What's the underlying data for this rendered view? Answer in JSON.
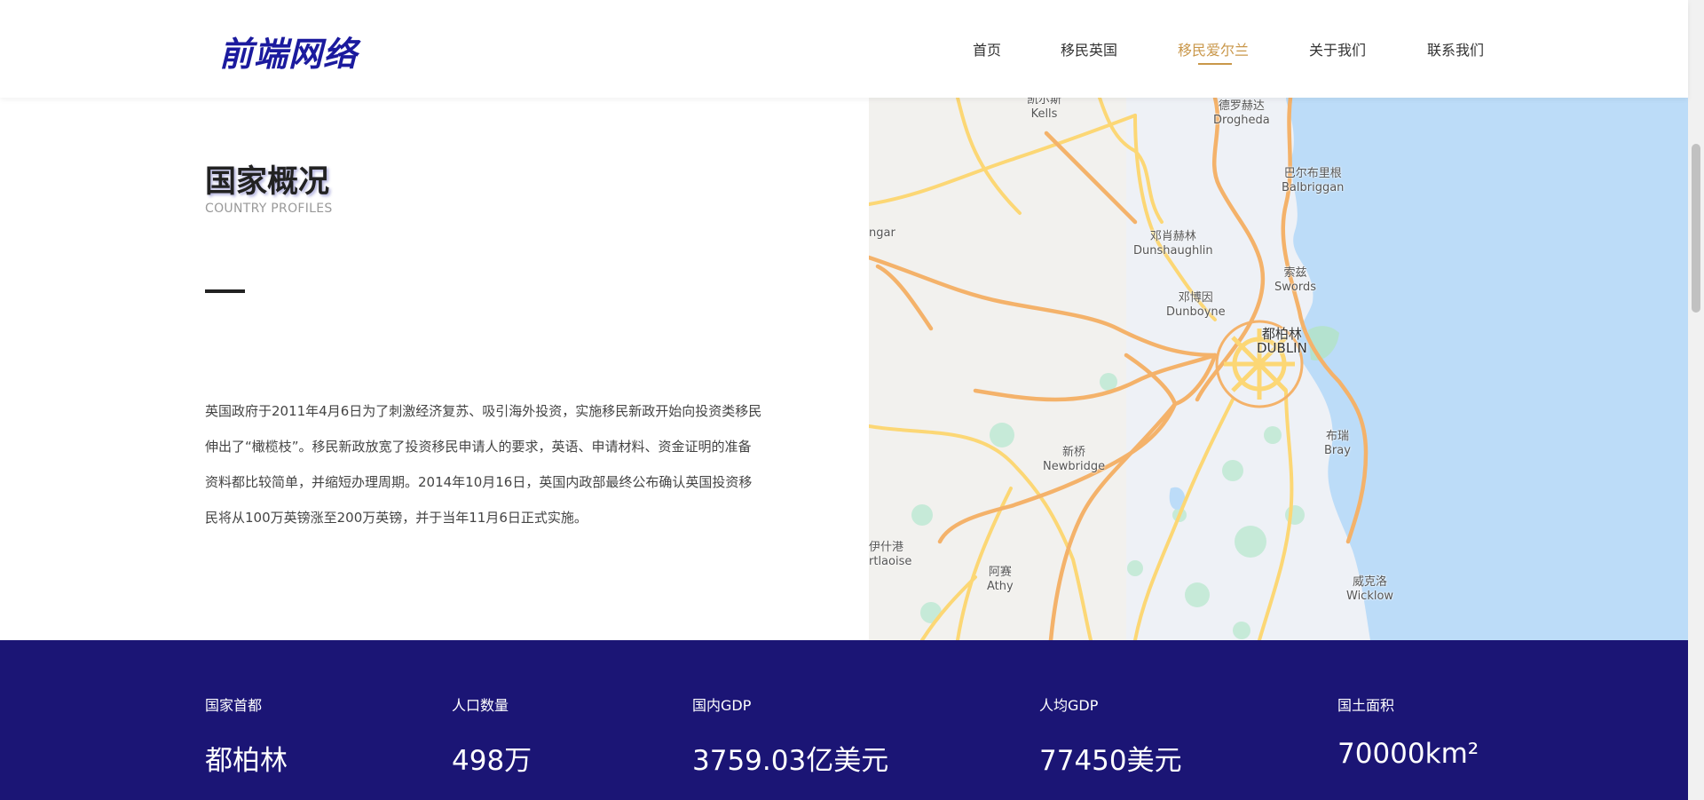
{
  "header": {
    "logo": "前端网络",
    "nav": [
      "首页",
      "移民英国",
      "移民爱尔兰",
      "关于我们",
      "联系我们"
    ],
    "active_index": 2,
    "accent_color": "#c9974a"
  },
  "intro": {
    "title": "国家概况",
    "subtitle": "COUNTRY PROFILES",
    "text": "英国政府于2011年4月6日为了刺激经济复苏、吸引海外投资，实施移民新政开始向投资类移民伸出了“橄榄枝”。移民新政放宽了投资移民申请人的要求，英语、申请材料、资金证明的准备资料都比较简单，并缩短办理周期。2014年10月16日，英国内政部最终公布确认英国投资移民将从100万英镑涨至200万英镑，并于当年11月6日正式实施。"
  },
  "map": {
    "labels": [
      {
        "zh": "凯尔斯",
        "en": "Kells"
      },
      {
        "zh": "德罗赫达",
        "en": "Drogheda"
      },
      {
        "zh": "巴尔布里根",
        "en": "Balbriggan"
      },
      {
        "zh": "",
        "en": "ngar"
      },
      {
        "zh": "邓肖赫林",
        "en": "Dunshaughlin"
      },
      {
        "zh": "索兹",
        "en": "Swords"
      },
      {
        "zh": "邓博因",
        "en": "Dunboyne"
      },
      {
        "zh": "都柏林",
        "en": "DUBLIN"
      },
      {
        "zh": "布瑞",
        "en": "Bray"
      },
      {
        "zh": "新桥",
        "en": "Newbridge"
      },
      {
        "zh": "伊什港",
        "en": "rtlaoise"
      },
      {
        "zh": "阿赛",
        "en": "Athy"
      },
      {
        "zh": "威克洛",
        "en": "Wicklow"
      }
    ]
  },
  "stats": [
    {
      "label": "国家首都",
      "value": "都柏林"
    },
    {
      "label": "人口数量",
      "value": "498万"
    },
    {
      "label": "国内GDP",
      "value": "3759.03亿美元"
    },
    {
      "label": "人均GDP",
      "value": "77450美元"
    },
    {
      "label": "国土面积",
      "value": "70000km²"
    }
  ],
  "colors": {
    "stats_bg": "#1b1575",
    "logo": "#1b1a9e",
    "sea": "#bcdcf8",
    "road_major": "#f4b26a",
    "road_minor": "#fcd775"
  }
}
